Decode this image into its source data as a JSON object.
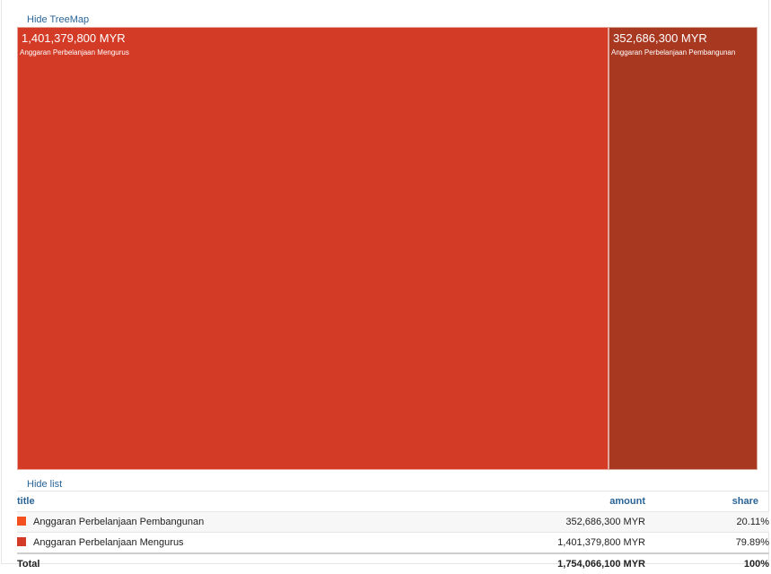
{
  "links": {
    "hide_treemap": "Hide TreeMap",
    "hide_list": "Hide list"
  },
  "treemap": {
    "tiles": [
      {
        "amount": "1,401,379,800 MYR",
        "label": "Anggaran Perbelanjaan Mengurus",
        "color": "#d33b27",
        "share": 0.7989
      },
      {
        "amount": "352,686,300 MYR",
        "label": "Anggaran Perbelanjaan Pembangunan",
        "color": "#a93821",
        "share": 0.2011
      }
    ]
  },
  "table": {
    "headers": {
      "title": "title",
      "amount": "amount",
      "share": "share"
    },
    "rows": [
      {
        "title": "Anggaran Perbelanjaan Pembangunan",
        "amount": "352,686,300 MYR",
        "share": "20.11%",
        "color": "#f4511e"
      },
      {
        "title": "Anggaran Perbelanjaan Mengurus",
        "amount": "1,401,379,800 MYR",
        "share": "79.89%",
        "color": "#d33b27"
      }
    ],
    "total": {
      "title": "Total",
      "amount": "1,754,066,100 MYR",
      "share": "100%"
    }
  }
}
